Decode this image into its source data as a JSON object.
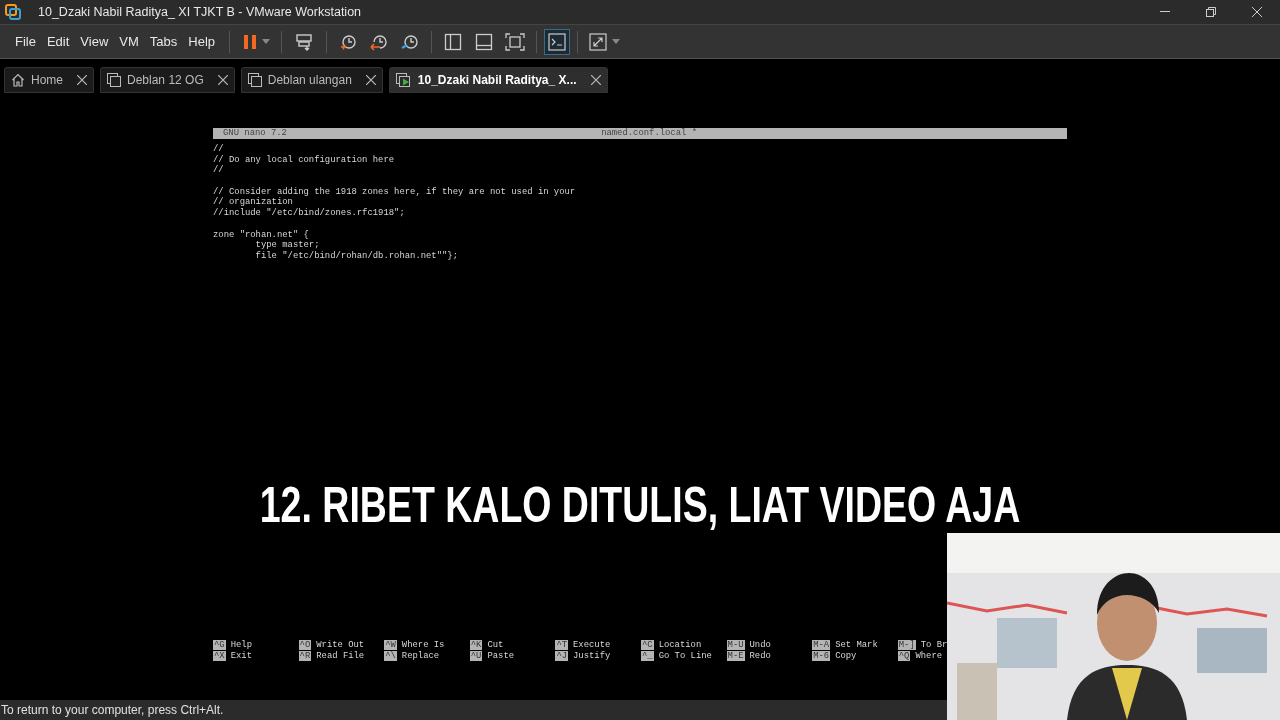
{
  "window": {
    "title": "10_Dzaki Nabil Raditya_ XI TJKT B - VMware Workstation"
  },
  "menu": {
    "items": [
      "File",
      "Edit",
      "View",
      "VM",
      "Tabs",
      "Help"
    ]
  },
  "tabs": [
    {
      "label": "Home",
      "kind": "home",
      "selected": false
    },
    {
      "label": "Deblan 12 OG",
      "kind": "vm",
      "selected": false
    },
    {
      "label": "Deblan ulangan",
      "kind": "vm",
      "selected": false
    },
    {
      "label": "10_Dzaki Nabil Raditya_ X...",
      "kind": "running",
      "selected": true
    }
  ],
  "editor": {
    "app": "GNU nano 7.2",
    "filename": "named.conf.local *",
    "paragraphs": [
      [
        "//",
        "// Do any local configuration here",
        "//"
      ],
      [
        "// Consider adding the 1918 zones here, if they are not used in your",
        "// organization",
        "//include \"/etc/bind/zones.rfc1918\";"
      ],
      [
        "zone \"rohan.net\" {",
        "        type master;",
        "        file \"/etc/bind/rohan/db.rohan.net\"\"};"
      ]
    ],
    "shortcut_rows": [
      [
        {
          "key": "^G",
          "label": "Help"
        },
        {
          "key": "^O",
          "label": "Write Out"
        },
        {
          "key": "^W",
          "label": "Where Is"
        },
        {
          "key": "^K",
          "label": "Cut"
        },
        {
          "key": "^T",
          "label": "Execute"
        },
        {
          "key": "^C",
          "label": "Location"
        },
        {
          "key": "M-U",
          "label": "Undo"
        },
        {
          "key": "M-A",
          "label": "Set Mark"
        },
        {
          "key": "M-]",
          "label": "To Br"
        }
      ],
      [
        {
          "key": "^X",
          "label": "Exit"
        },
        {
          "key": "^R",
          "label": "Read File"
        },
        {
          "key": "^\\",
          "label": "Replace"
        },
        {
          "key": "^U",
          "label": "Paste"
        },
        {
          "key": "^J",
          "label": "Justify"
        },
        {
          "key": "^_",
          "label": "Go To Line"
        },
        {
          "key": "M-E",
          "label": "Redo"
        },
        {
          "key": "M-6",
          "label": "Copy"
        },
        {
          "key": "^Q",
          "label": "Where"
        }
      ]
    ]
  },
  "caption": "12. RIBET KALO DITULIS, LIAT VIDEO AJA",
  "status_bar": {
    "text": "To return to your computer, press Ctrl+Alt."
  }
}
